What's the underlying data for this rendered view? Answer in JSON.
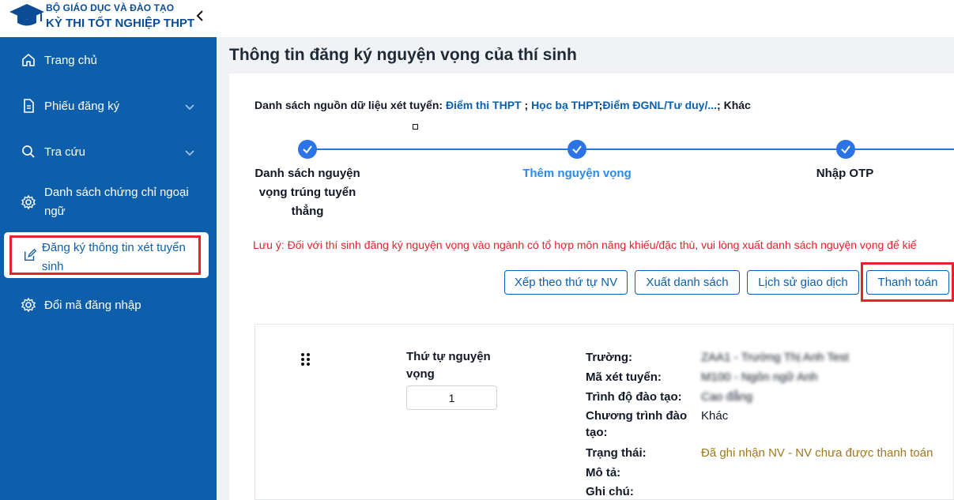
{
  "header": {
    "brand_line1": "BỘ GIÁO DỤC VÀ ĐÀO TẠO",
    "brand_line2": "KỲ THI TỐT NGHIỆP THPT"
  },
  "sidebar": {
    "items": [
      {
        "label": "Trang chủ",
        "icon": "home-icon"
      },
      {
        "label": "Phiếu đăng ký",
        "icon": "document-icon"
      },
      {
        "label": "Tra cứu",
        "icon": "search-icon"
      },
      {
        "label": "Danh sách chứng chỉ ngoại ngữ",
        "icon": "gear-icon"
      },
      {
        "label": "Đăng ký thông tin xét tuyển sinh",
        "icon": "edit-icon"
      },
      {
        "label": "Đổi mã đăng nhập",
        "icon": "gear-icon"
      }
    ]
  },
  "page": {
    "title": "Thông tin đăng ký nguyện vọng của thí sinh",
    "sources_prefix": "Danh sách nguồn dữ liệu xét tuyển: ",
    "sources": [
      "Điểm thi THPT",
      "Học bạ THPT",
      "Điểm ĐGNL/Tư duy/..."
    ],
    "sources_other": "Khác",
    "sep": " ; ",
    "sep2": ";"
  },
  "steps": [
    {
      "label": "Danh sách nguyện vọng trúng tuyển thẳng"
    },
    {
      "label": "Thêm nguyện vọng"
    },
    {
      "label": "Nhập OTP"
    }
  ],
  "note": "Lưu ý: Đối với thí sinh đăng ký nguyện vọng vào ngành có tổ hợp môn năng khiếu/đặc thù, vui lòng xuất danh sách nguyện vọng để kiể",
  "buttons": {
    "sort": "Xếp theo thứ tự NV",
    "export": "Xuất danh sách",
    "history": "Lịch sử giao dịch",
    "pay": "Thanh toán"
  },
  "item": {
    "order_label": "Thứ tự nguyện vọng",
    "order_value": "1",
    "fields": [
      {
        "label": "Trường:",
        "value": "ZAA1 - Trường Thị Anh Test"
      },
      {
        "label": "Mã xét tuyển:",
        "value": "M100 - Ngôn ngữ Anh"
      },
      {
        "label": "Trình độ đào tạo:",
        "value": "Cao đẳng"
      },
      {
        "label": "Chương trình đào tạo:",
        "value": "Khác"
      },
      {
        "label": "Trạng thái:",
        "value": "Đã ghi nhận NV - NV chưa được thanh toán"
      },
      {
        "label": "Mô tả:",
        "value": ""
      },
      {
        "label": "Ghi chú:",
        "value": ""
      }
    ]
  },
  "colors": {
    "sidebar": "#0d5fac",
    "accent": "#2b74e6",
    "highlight": "#e8212b",
    "status": "#a0781f"
  }
}
